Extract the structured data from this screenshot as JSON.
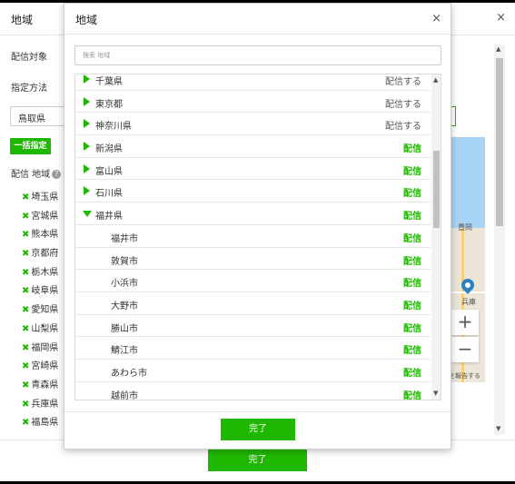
{
  "background": {
    "title": "地域",
    "close": "×",
    "target_label": "配信対象",
    "method_label": "指定方法",
    "select_value": "鳥取県",
    "bulk_button": "一括指定",
    "region_label": "配信 地域",
    "help": "?",
    "remove_mark": "✖",
    "prefectures": [
      "埼玉県",
      "宮城県",
      "熊本県",
      "京都府",
      "栃木県",
      "岐阜県",
      "愛知県",
      "山梨県",
      "福岡県",
      "宮崎県",
      "青森県",
      "兵庫県",
      "福島県"
    ],
    "map": {
      "city1": "豊岡",
      "city2": "兵庫",
      "zoom_in": "+",
      "zoom_out": "−",
      "copyright": "を報告する"
    },
    "done": "完了"
  },
  "modal": {
    "title": "地域",
    "close": "×",
    "search_placeholder": "検索 地域",
    "rows": [
      {
        "name": "千葉県",
        "action": "配信する",
        "level": "parent",
        "state": "plain"
      },
      {
        "name": "東京都",
        "action": "配信する",
        "level": "parent",
        "state": "plain"
      },
      {
        "name": "神奈川県",
        "action": "配信する",
        "level": "parent",
        "state": "plain"
      },
      {
        "name": "新潟県",
        "action": "配信",
        "level": "parent",
        "state": "strong"
      },
      {
        "name": "富山県",
        "action": "配信",
        "level": "parent",
        "state": "strong"
      },
      {
        "name": "石川県",
        "action": "配信",
        "level": "parent",
        "state": "strong"
      },
      {
        "name": "福井県",
        "action": "配信",
        "level": "parent",
        "state": "strong",
        "open": true
      },
      {
        "name": "福井市",
        "action": "配信",
        "level": "child",
        "state": "strong"
      },
      {
        "name": "敦賀市",
        "action": "配信",
        "level": "child",
        "state": "strong"
      },
      {
        "name": "小浜市",
        "action": "配信",
        "level": "child",
        "state": "strong"
      },
      {
        "name": "大野市",
        "action": "配信",
        "level": "child",
        "state": "strong"
      },
      {
        "name": "勝山市",
        "action": "配信",
        "level": "child",
        "state": "strong"
      },
      {
        "name": "鯖江市",
        "action": "配信",
        "level": "child",
        "state": "strong"
      },
      {
        "name": "あわら市",
        "action": "配信",
        "level": "child",
        "state": "strong"
      },
      {
        "name": "越前市",
        "action": "配信",
        "level": "child",
        "state": "strong"
      }
    ],
    "scroll_up": "▲",
    "scroll_down": "▼",
    "done": "完了"
  },
  "colors": {
    "accent": "#1fb800",
    "map_sea": "#a8d4f5",
    "map_land": "#ece6d9",
    "pin": "#2a81c9"
  }
}
